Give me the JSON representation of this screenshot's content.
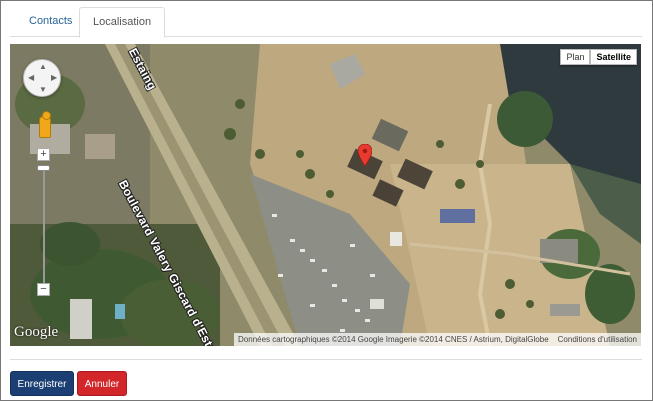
{
  "tabs": [
    {
      "label": "Contacts",
      "active": false
    },
    {
      "label": "Localisation",
      "active": true
    }
  ],
  "map": {
    "map_types": [
      "Plan",
      "Satellite"
    ],
    "active_map_type": "Satellite",
    "zoom_in_label": "+",
    "zoom_out_label": "−",
    "road_label": "Boulevard Valery Giscard d'Estaing",
    "road_label_top": "Estaing",
    "logo_text": "Google",
    "attribution": "Données cartographiques ©2014 Google Imagerie ©2014 CNES / Astrium, DigitalGlobe",
    "terms_link": "Conditions d'utilisation",
    "marker_color": "#e83a2f"
  },
  "actions": {
    "save_label": "Enregistrer",
    "cancel_label": "Annuler"
  },
  "colors": {
    "save_button": "#1b3f73",
    "cancel_button": "#d2262b",
    "active_link": "#2a6496"
  }
}
